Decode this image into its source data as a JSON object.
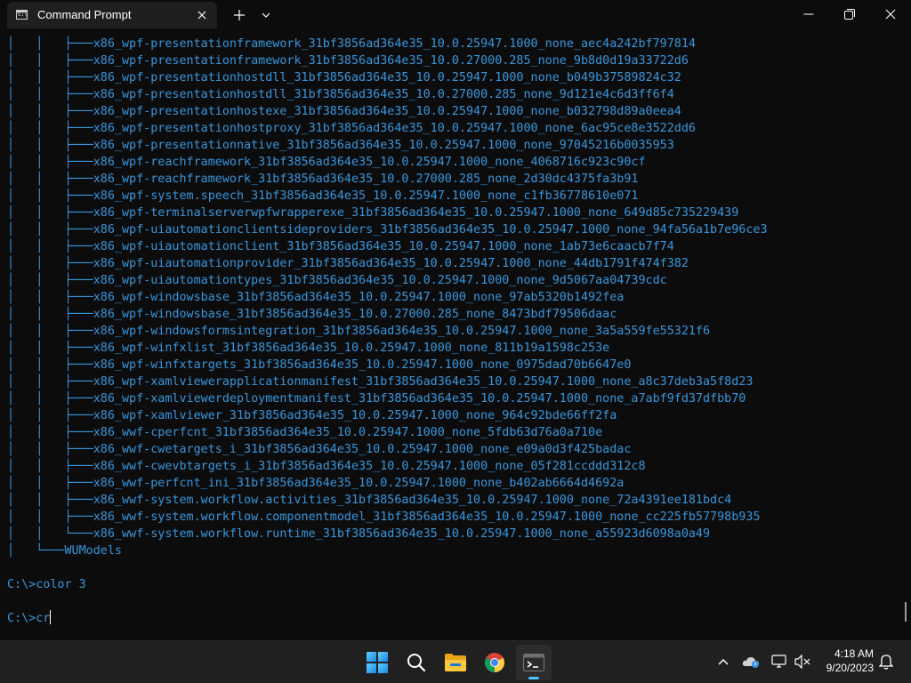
{
  "window": {
    "tab_title": "Command Prompt",
    "icons": {
      "tab": "cmd-icon",
      "close_tab": "close-icon",
      "new_tab": "plus-icon",
      "dropdown": "chevron-down-icon",
      "minimize": "minimize-icon",
      "maximize": "maximize-icon",
      "close": "close-icon"
    }
  },
  "console": {
    "text_color": "#3a96dd",
    "background": "#0c0c0c",
    "lines": [
      "│   │   ├───x86_wpf-presentationframework_31bf3856ad364e35_10.0.25947.1000_none_aec4a242bf797814",
      "│   │   ├───x86_wpf-presentationframework_31bf3856ad364e35_10.0.27000.285_none_9b8d0d19a33722d6",
      "│   │   ├───x86_wpf-presentationhostdll_31bf3856ad364e35_10.0.25947.1000_none_b049b37589824c32",
      "│   │   ├───x86_wpf-presentationhostdll_31bf3856ad364e35_10.0.27000.285_none_9d121e4c6d3ff6f4",
      "│   │   ├───x86_wpf-presentationhostexe_31bf3856ad364e35_10.0.25947.1000_none_b032798d89a0eea4",
      "│   │   ├───x86_wpf-presentationhostproxy_31bf3856ad364e35_10.0.25947.1000_none_6ac95ce8e3522dd6",
      "│   │   ├───x86_wpf-presentationnative_31bf3856ad364e35_10.0.25947.1000_none_97045216b0035953",
      "│   │   ├───x86_wpf-reachframework_31bf3856ad364e35_10.0.25947.1000_none_4068716c923c90cf",
      "│   │   ├───x86_wpf-reachframework_31bf3856ad364e35_10.0.27000.285_none_2d30dc4375fa3b91",
      "│   │   ├───x86_wpf-system.speech_31bf3856ad364e35_10.0.25947.1000_none_c1fb36778610e071",
      "│   │   ├───x86_wpf-terminalserverwpfwrapperexe_31bf3856ad364e35_10.0.25947.1000_none_649d85c735229439",
      "│   │   ├───x86_wpf-uiautomationclientsideproviders_31bf3856ad364e35_10.0.25947.1000_none_94fa56a1b7e96ce3",
      "│   │   ├───x86_wpf-uiautomationclient_31bf3856ad364e35_10.0.25947.1000_none_1ab73e6caacb7f74",
      "│   │   ├───x86_wpf-uiautomationprovider_31bf3856ad364e35_10.0.25947.1000_none_44db1791f474f382",
      "│   │   ├───x86_wpf-uiautomationtypes_31bf3856ad364e35_10.0.25947.1000_none_9d5067aa04739cdc",
      "│   │   ├───x86_wpf-windowsbase_31bf3856ad364e35_10.0.25947.1000_none_97ab5320b1492fea",
      "│   │   ├───x86_wpf-windowsbase_31bf3856ad364e35_10.0.27000.285_none_8473bdf79506daac",
      "│   │   ├───x86_wpf-windowsformsintegration_31bf3856ad364e35_10.0.25947.1000_none_3a5a559fe55321f6",
      "│   │   ├───x86_wpf-winfxlist_31bf3856ad364e35_10.0.25947.1000_none_811b19a1598c253e",
      "│   │   ├───x86_wpf-winfxtargets_31bf3856ad364e35_10.0.25947.1000_none_0975dad70b6647e0",
      "│   │   ├───x86_wpf-xamlviewerapplicationmanifest_31bf3856ad364e35_10.0.25947.1000_none_a8c37deb3a5f8d23",
      "│   │   ├───x86_wpf-xamlviewerdeploymentmanifest_31bf3856ad364e35_10.0.25947.1000_none_a7abf9fd37dfbb70",
      "│   │   ├───x86_wpf-xamlviewer_31bf3856ad364e35_10.0.25947.1000_none_964c92bde66ff2fa",
      "│   │   ├───x86_wwf-cperfcnt_31bf3856ad364e35_10.0.25947.1000_none_5fdb63d76a0a710e",
      "│   │   ├───x86_wwf-cwetargets_i_31bf3856ad364e35_10.0.25947.1000_none_e09a0d3f425badac",
      "│   │   ├───x86_wwf-cwevbtargets_i_31bf3856ad364e35_10.0.25947.1000_none_05f281ccddd312c8",
      "│   │   ├───x86_wwf-perfcnt_ini_31bf3856ad364e35_10.0.25947.1000_none_b402ab6664d4692a",
      "│   │   ├───x86_wwf-system.workflow.activities_31bf3856ad364e35_10.0.25947.1000_none_72a4391ee181bdc4",
      "│   │   ├───x86_wwf-system.workflow.componentmodel_31bf3856ad364e35_10.0.25947.1000_none_cc225fb57798b935",
      "│   │   └───x86_wwf-system.workflow.runtime_31bf3856ad364e35_10.0.25947.1000_none_a55923d6098a0a49",
      "│   └───WUModels",
      "",
      "C:\\>color 3",
      "",
      "C:\\>cr"
    ]
  },
  "taskbar": {
    "apps": [
      {
        "name": "start-icon"
      },
      {
        "name": "search-icon"
      },
      {
        "name": "file-explorer-icon"
      },
      {
        "name": "chrome-icon"
      },
      {
        "name": "terminal-icon"
      }
    ],
    "tray": [
      "chevron-up-icon",
      "onedrive-icon",
      "network-icon",
      "volume-muted-icon",
      "notification-bell-icon"
    ],
    "time": "4:18 AM",
    "date": "9/20/2023",
    "accent": "#4cc2ff"
  }
}
